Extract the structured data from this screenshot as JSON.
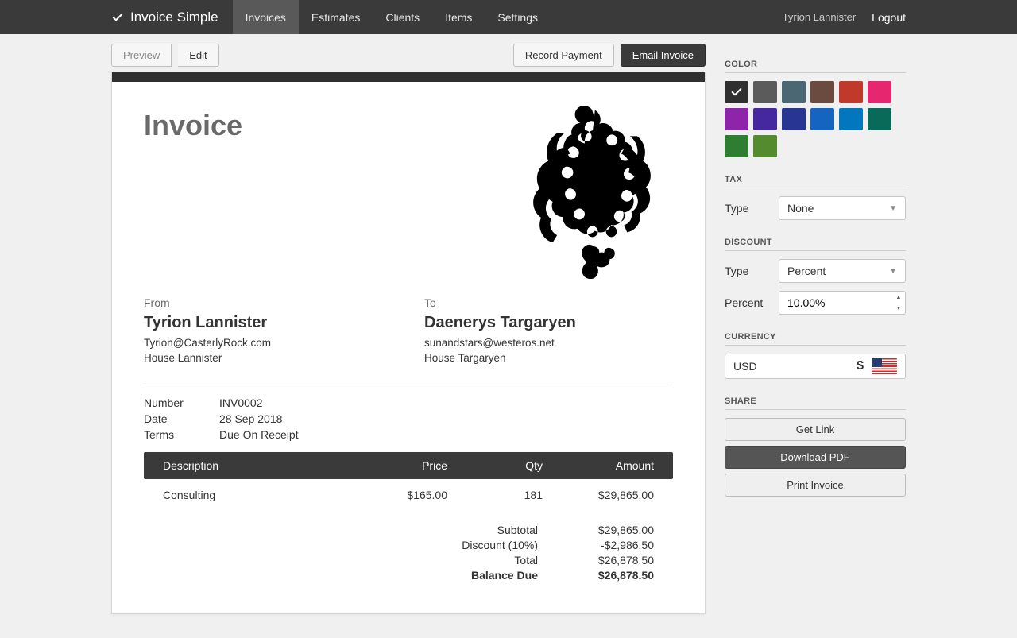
{
  "brand": "Invoice Simple",
  "nav": {
    "tabs": [
      "Invoices",
      "Estimates",
      "Clients",
      "Items",
      "Settings"
    ],
    "active_tab": "Invoices",
    "user": "Tyrion Lannister",
    "logout": "Logout"
  },
  "toolbar": {
    "preview": "Preview",
    "edit": "Edit",
    "record_payment": "Record Payment",
    "email_invoice": "Email Invoice"
  },
  "invoice": {
    "title": "Invoice",
    "from_label": "From",
    "from_name": "Tyrion Lannister",
    "from_email": "Tyrion@CasterlyRock.com",
    "from_org": "House Lannister",
    "to_label": "To",
    "to_name": "Daenerys Targaryen",
    "to_email": "sunandstars@westeros.net",
    "to_org": "House Targaryen",
    "meta": {
      "number_label": "Number",
      "number_value": "INV0002",
      "date_label": "Date",
      "date_value": "28 Sep 2018",
      "terms_label": "Terms",
      "terms_value": "Due On Receipt"
    },
    "columns": {
      "description": "Description",
      "price": "Price",
      "qty": "Qty",
      "amount": "Amount"
    },
    "items": [
      {
        "description": "Consulting",
        "price": "$165.00",
        "qty": "181",
        "amount": "$29,865.00"
      }
    ],
    "totals": {
      "subtotal_label": "Subtotal",
      "subtotal": "$29,865.00",
      "discount_label": "Discount (10%)",
      "discount": "-$2,986.50",
      "total_label": "Total",
      "total": "$26,878.50",
      "balance_label": "Balance Due",
      "balance": "$26,878.50"
    }
  },
  "sidebar": {
    "color": {
      "title": "COLOR",
      "swatches": [
        "#302f2f",
        "#5b5b5b",
        "#4a6773",
        "#6b4b3f",
        "#c0392b",
        "#e6266e",
        "#8e24aa",
        "#4527a0",
        "#283593",
        "#1565c0",
        "#0277bd",
        "#0a6a5a",
        "#2e7d32",
        "#558b2f"
      ],
      "selected_index": 0
    },
    "tax": {
      "title": "TAX",
      "type_label": "Type",
      "type_value": "None"
    },
    "discount": {
      "title": "DISCOUNT",
      "type_label": "Type",
      "type_value": "Percent",
      "percent_label": "Percent",
      "percent_value": "10.00%"
    },
    "currency": {
      "title": "CURRENCY",
      "code": "USD",
      "symbol": "$"
    },
    "share": {
      "title": "SHARE",
      "get_link": "Get Link",
      "download_pdf": "Download PDF",
      "print": "Print Invoice"
    }
  }
}
